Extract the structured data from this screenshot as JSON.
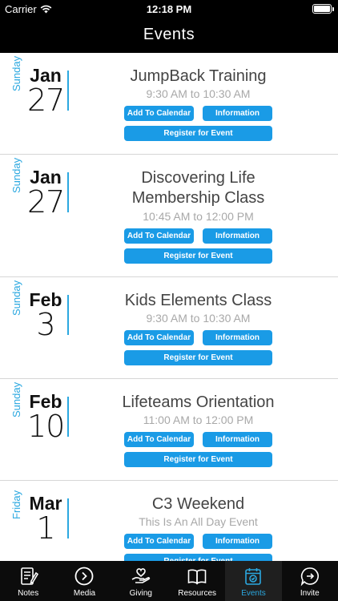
{
  "status": {
    "carrier": "Carrier",
    "time": "12:18 PM"
  },
  "nav": {
    "title": "Events"
  },
  "events": [
    {
      "weekday": "Sunday",
      "month": "Jan",
      "day": "27",
      "title": "JumpBack Training",
      "time": "9:30 AM to 10:30 AM"
    },
    {
      "weekday": "Sunday",
      "month": "Jan",
      "day": "27",
      "title": "Discovering Life Membership Class",
      "time": "10:45 AM to 12:00 PM"
    },
    {
      "weekday": "Sunday",
      "month": "Feb",
      "day": "3",
      "title": "Kids Elements Class",
      "time": "9:30 AM to 10:30 AM"
    },
    {
      "weekday": "Sunday",
      "month": "Feb",
      "day": "10",
      "title": "Lifeteams Orientation",
      "time": "11:00 AM to 12:00 PM"
    },
    {
      "weekday": "Friday",
      "month": "Mar",
      "day": "1",
      "title": "C3 Weekend",
      "time": "This Is An All Day Event"
    }
  ],
  "buttons": {
    "add_calendar": "Add To Calendar",
    "information": "Information",
    "register": "Register for Event"
  },
  "tabs": [
    {
      "label": "Notes",
      "icon": "notes-icon",
      "active": false
    },
    {
      "label": "Media",
      "icon": "media-icon",
      "active": false
    },
    {
      "label": "Giving",
      "icon": "giving-icon",
      "active": false
    },
    {
      "label": "Resources",
      "icon": "resources-icon",
      "active": false
    },
    {
      "label": "Events",
      "icon": "events-icon",
      "active": true
    },
    {
      "label": "Invite",
      "icon": "invite-icon",
      "active": false
    }
  ],
  "colors": {
    "accent": "#2ba8e0",
    "button": "#1a9be6",
    "bar": "#000000"
  }
}
